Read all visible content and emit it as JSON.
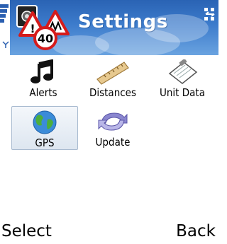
{
  "header": {
    "title": "Settings",
    "app_icon": "speed-camera-warning-icon",
    "speed_sign_text": "40",
    "status_icons": [
      "signal-strength-icon",
      "antenna-icon",
      "connectivity-icon"
    ]
  },
  "grid": {
    "items": [
      {
        "label": "Alerts",
        "icon": "music-note-icon"
      },
      {
        "label": "Distances",
        "icon": "ruler-icon"
      },
      {
        "label": "Unit Data",
        "icon": "clipboard-icon"
      },
      {
        "label": "GPS",
        "icon": "globe-icon",
        "selected": true
      },
      {
        "label": "Update",
        "icon": "refresh-arrows-icon"
      }
    ]
  },
  "softkeys": {
    "left": "Select",
    "right": "Back"
  },
  "colors": {
    "header_top": "#2a63b4",
    "header_bottom": "#6aa3e0",
    "selection_border": "#a9bbd0"
  }
}
